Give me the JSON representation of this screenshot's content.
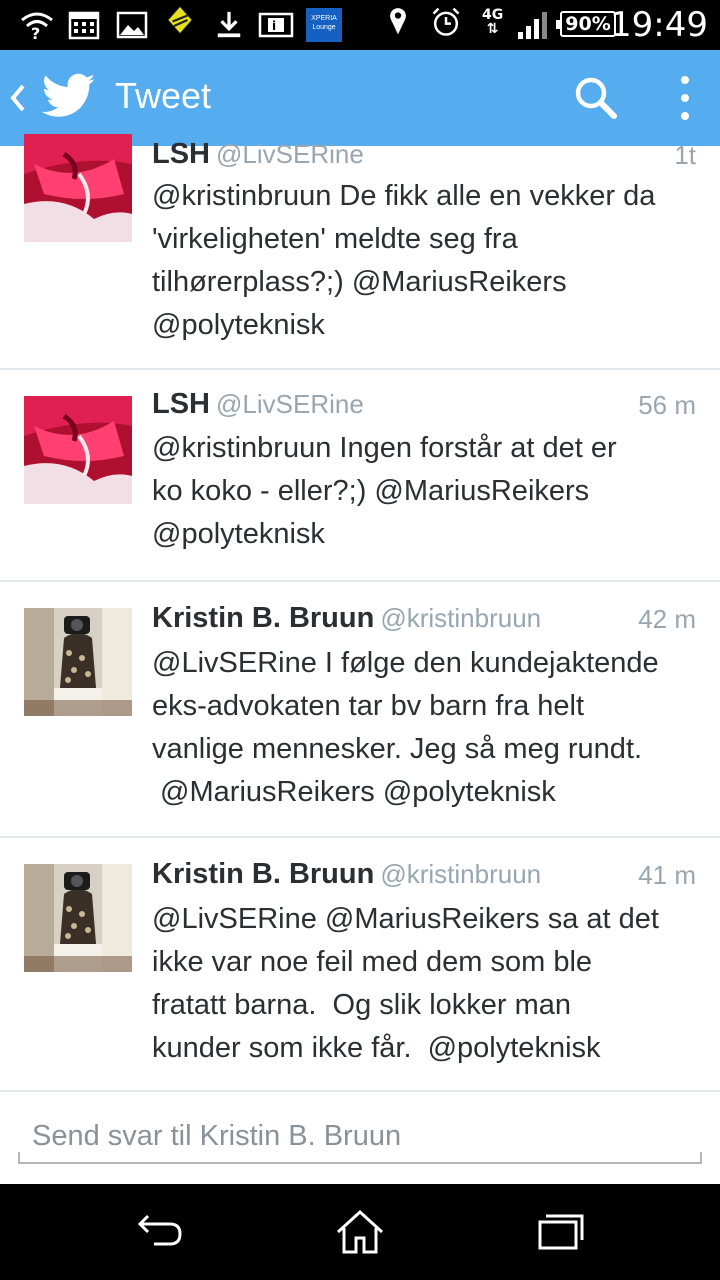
{
  "status_bar": {
    "time": "19:49",
    "battery": "90%",
    "network": "4G",
    "app_badge": "XPERIA Lounge",
    "icons": [
      "wifi-question-icon",
      "calendar-icon",
      "image-icon",
      "app-icon",
      "download-icon",
      "info-icon",
      "xperia-lounge-icon",
      "location-icon",
      "alarm-icon",
      "network-4g-icon",
      "signal-icon",
      "battery-icon"
    ]
  },
  "header": {
    "title": "Tweet",
    "icons": [
      "back-icon",
      "twitter-bird-icon",
      "search-icon",
      "overflow-menu-icon"
    ]
  },
  "tweets": [
    {
      "name": "LSH",
      "handle": "@LivSERine",
      "time": "1t",
      "lines": [
        "@kristinbruun De fikk alle en vekker da",
        "'virkeligheten' meldte seg fra",
        "tilhørerplass?;) @MariusReikers",
        "@polyteknisk"
      ]
    },
    {
      "name": "LSH",
      "handle": "@LivSERine",
      "time": "56 m",
      "lines": [
        "@kristinbruun Ingen forstår at det er",
        "ko koko - eller?;) @MariusReikers",
        "@polyteknisk"
      ]
    },
    {
      "name": "Kristin B. Bruun",
      "handle": "@kristinbruun",
      "time": "42 m",
      "lines": [
        "@LivSERine I følge den kundejaktende",
        "eks-advokaten tar bv barn fra helt",
        "vanlige mennesker. Jeg så meg rundt.",
        " @MariusReikers @polyteknisk"
      ]
    },
    {
      "name": "Kristin B. Bruun",
      "handle": "@kristinbruun",
      "time": "41 m",
      "lines": [
        "@LivSERine @MariusReikers sa at det",
        "ikke var noe feil med dem som ble",
        "fratatt barna.  Og slik lokker man",
        "kunder som ikke får.  @polyteknisk"
      ]
    }
  ],
  "reply": {
    "placeholder": "Send svar til Kristin B. Bruun",
    "value": ""
  },
  "nav": {
    "icons": [
      "back-nav-icon",
      "home-icon",
      "recent-apps-icon"
    ]
  },
  "colors": {
    "brand": "#55acee",
    "text": "#292f33",
    "muted": "#99a6b0",
    "divider": "#e1e8ed"
  }
}
